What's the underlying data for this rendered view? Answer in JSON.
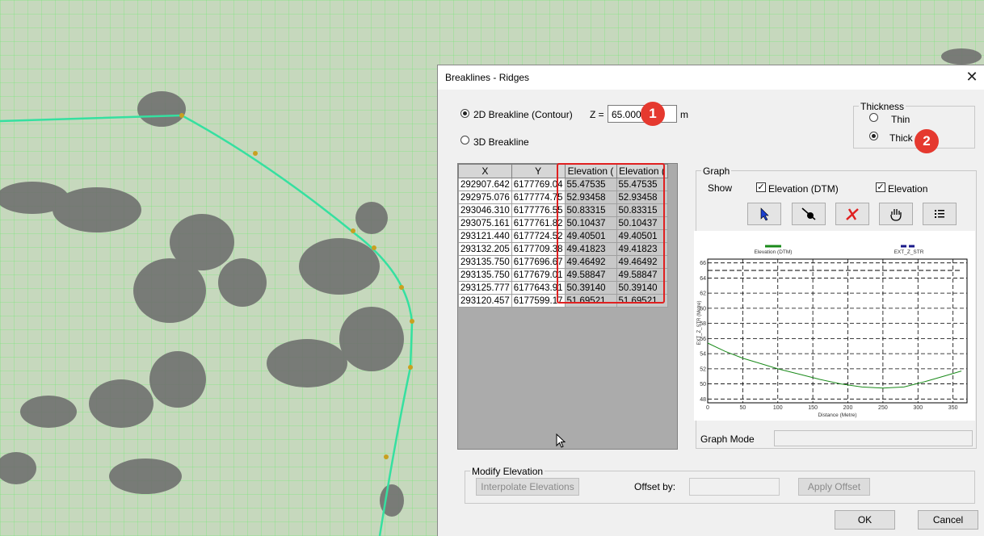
{
  "dialog": {
    "title": "Breaklines - Ridges",
    "close_glyph": "✕",
    "mode_2d_label": "2D Breakline (Contour)",
    "mode_3d_label": "3D Breakline",
    "z_label": "Z =",
    "z_value": "65.000",
    "z_unit": "m",
    "thickness": {
      "title": "Thickness",
      "thin_label": "Thin",
      "thick_label": "Thick",
      "selected": "Thick"
    }
  },
  "table": {
    "columns": [
      "X",
      "Y",
      "Elevation (",
      "Elevation ("
    ],
    "rows": [
      [
        "292907.642",
        "6177769.04",
        "55.47535",
        "55.47535"
      ],
      [
        "292975.076",
        "6177774.75",
        "52.93458",
        "52.93458"
      ],
      [
        "293046.310",
        "6177776.55",
        "50.83315",
        "50.83315"
      ],
      [
        "293075.161",
        "6177761.82",
        "50.10437",
        "50.10437"
      ],
      [
        "293121.440",
        "6177724.52",
        "49.40501",
        "49.40501"
      ],
      [
        "293132.205",
        "6177709.38",
        "49.41823",
        "49.41823"
      ],
      [
        "293135.750",
        "6177696.67",
        "49.46492",
        "49.46492"
      ],
      [
        "293135.750",
        "6177679.01",
        "49.58847",
        "49.58847"
      ],
      [
        "293125.777",
        "6177643.91",
        "50.39140",
        "50.39140"
      ],
      [
        "293120.457",
        "6177599.17",
        "51.69521",
        "51.69521"
      ]
    ]
  },
  "graph": {
    "title": "Graph",
    "show_label": "Show",
    "check_dtm_label": "Elevation (DTM)",
    "check_elev_label": "Elevation",
    "mode_label": "Graph Mode",
    "tools": [
      "pointer-icon",
      "point-pin-icon",
      "delete-x-icon",
      "pan-hand-icon",
      "list-icon"
    ]
  },
  "chart_data": {
    "type": "line",
    "legend": [
      "Elevation (DTM)",
      "EXT_Z_STR"
    ],
    "xlabel": "Distance (Metre)",
    "ylabel": "EXT_Z_STR (Metre)",
    "xlim": [
      0,
      370
    ],
    "ylim": [
      47.5,
      66.5
    ],
    "x_ticks": [
      0,
      50,
      100,
      150,
      200,
      250,
      300,
      350
    ],
    "y_ticks": [
      48,
      50,
      52,
      54,
      56,
      58,
      60,
      62,
      64,
      66
    ],
    "series": [
      {
        "name": "Elevation (DTM)",
        "color": "#1a8a1a",
        "x": [
          0,
          25,
          50,
          75,
          100,
          130,
          160,
          190,
          220,
          250,
          280,
          310,
          340,
          362
        ],
        "y": [
          55.4,
          54.3,
          53.4,
          52.7,
          52.0,
          51.3,
          50.6,
          50.0,
          49.6,
          49.45,
          49.6,
          50.3,
          51.1,
          51.7
        ]
      },
      {
        "name": "EXT_Z_STR",
        "color": "#1a1a8a",
        "dashed": true,
        "x": [
          0,
          362
        ],
        "y": [
          65.0,
          65.0
        ]
      }
    ]
  },
  "modify": {
    "title": "Modify Elevation",
    "interpolate_label": "Interpolate Elevations",
    "offset_label": "Offset by:",
    "apply_label": "Apply Offset"
  },
  "footer": {
    "ok_label": "OK",
    "cancel_label": "Cancel"
  },
  "annotations": {
    "marker1": "1",
    "marker2": "2",
    "highlight_color": "#e02020"
  }
}
